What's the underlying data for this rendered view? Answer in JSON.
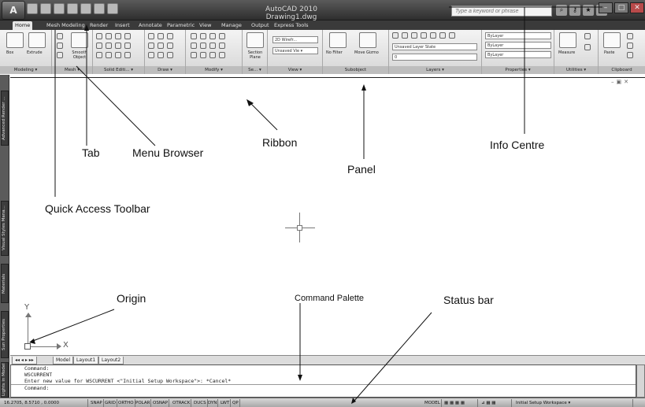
{
  "titlebar": {
    "logo": "A",
    "app_title": "AutoCAD 2010  Drawing1.dwg",
    "search_placeholder": "Type a keyword or phrase",
    "info_icons": [
      "search-icon",
      "key-icon",
      "star-icon",
      "help-icon"
    ],
    "window_buttons": [
      "minimize",
      "maximize",
      "close"
    ]
  },
  "tabs": [
    "Home",
    "Mesh Modeling",
    "Render",
    "Insert",
    "Annotate",
    "Parametric",
    "View",
    "Manage",
    "Output",
    "Express Tools"
  ],
  "active_tab": "Home",
  "ribbon": {
    "panels": [
      {
        "title": "Modeling ▾",
        "buttons": [
          "Box",
          "Extrude"
        ]
      },
      {
        "title": "Mesh ▾",
        "buttons": [
          "Smooth Object"
        ]
      },
      {
        "title": "Solid Editi... ▾",
        "buttons": []
      },
      {
        "title": "Draw ▾",
        "buttons": []
      },
      {
        "title": "Modify ▾",
        "buttons": []
      },
      {
        "title": "Se... ▾",
        "buttons": [
          "Section Plane"
        ]
      },
      {
        "title": "View ▾",
        "buttons": [
          "2D Wirefr...",
          "Unsaved Vie ▾"
        ]
      },
      {
        "title": "Subobject",
        "buttons": [
          "No Filter",
          "Move Gizmo"
        ]
      },
      {
        "title": "Layers ▾",
        "buttons": [
          "Unsaved Layer State",
          "0"
        ]
      },
      {
        "title": "Properties ▾",
        "buttons": [
          "ByLayer",
          "ByLayer",
          "ByLayer"
        ]
      },
      {
        "title": "Utilities ▾",
        "buttons": [
          "Measure"
        ]
      },
      {
        "title": "Clipboard",
        "buttons": [
          "Paste"
        ]
      }
    ]
  },
  "palettes": [
    "Advanced Render ...",
    "Visual Styles Mana...",
    "Materials",
    "Sun Properties",
    "Lights in Model"
  ],
  "layout_tabs": [
    "Model",
    "Layout1",
    "Layout2"
  ],
  "command": {
    "lines": [
      "Command:",
      "WSCURRENT",
      "Enter new value for WSCURRENT <\"Initial Setup Workspace\">: *Cancel*"
    ],
    "prompt": "Command:"
  },
  "status": {
    "coords": "16.2705, 8.5710 , 0.0000",
    "toggles": [
      "SNAP",
      "GRID",
      "ORTHO",
      "POLAR",
      "OSNAP",
      "OTRACK",
      "DUCS",
      "DYN",
      "LWT",
      "QP"
    ],
    "right_label": "MODEL",
    "workspace": "Initial Setup Workspace ▾"
  },
  "ucs": {
    "x_label": "X",
    "y_label": "Y"
  },
  "annotations": {
    "tab": "Tab",
    "menu_browser": "Menu Browser",
    "ribbon": "Ribbon",
    "info_centre": "Info Centre",
    "panel": "Panel",
    "quick_access": "Quick Access Toolbar",
    "origin": "Origin",
    "command_palette": "Command Palette",
    "status_bar": "Status bar"
  }
}
